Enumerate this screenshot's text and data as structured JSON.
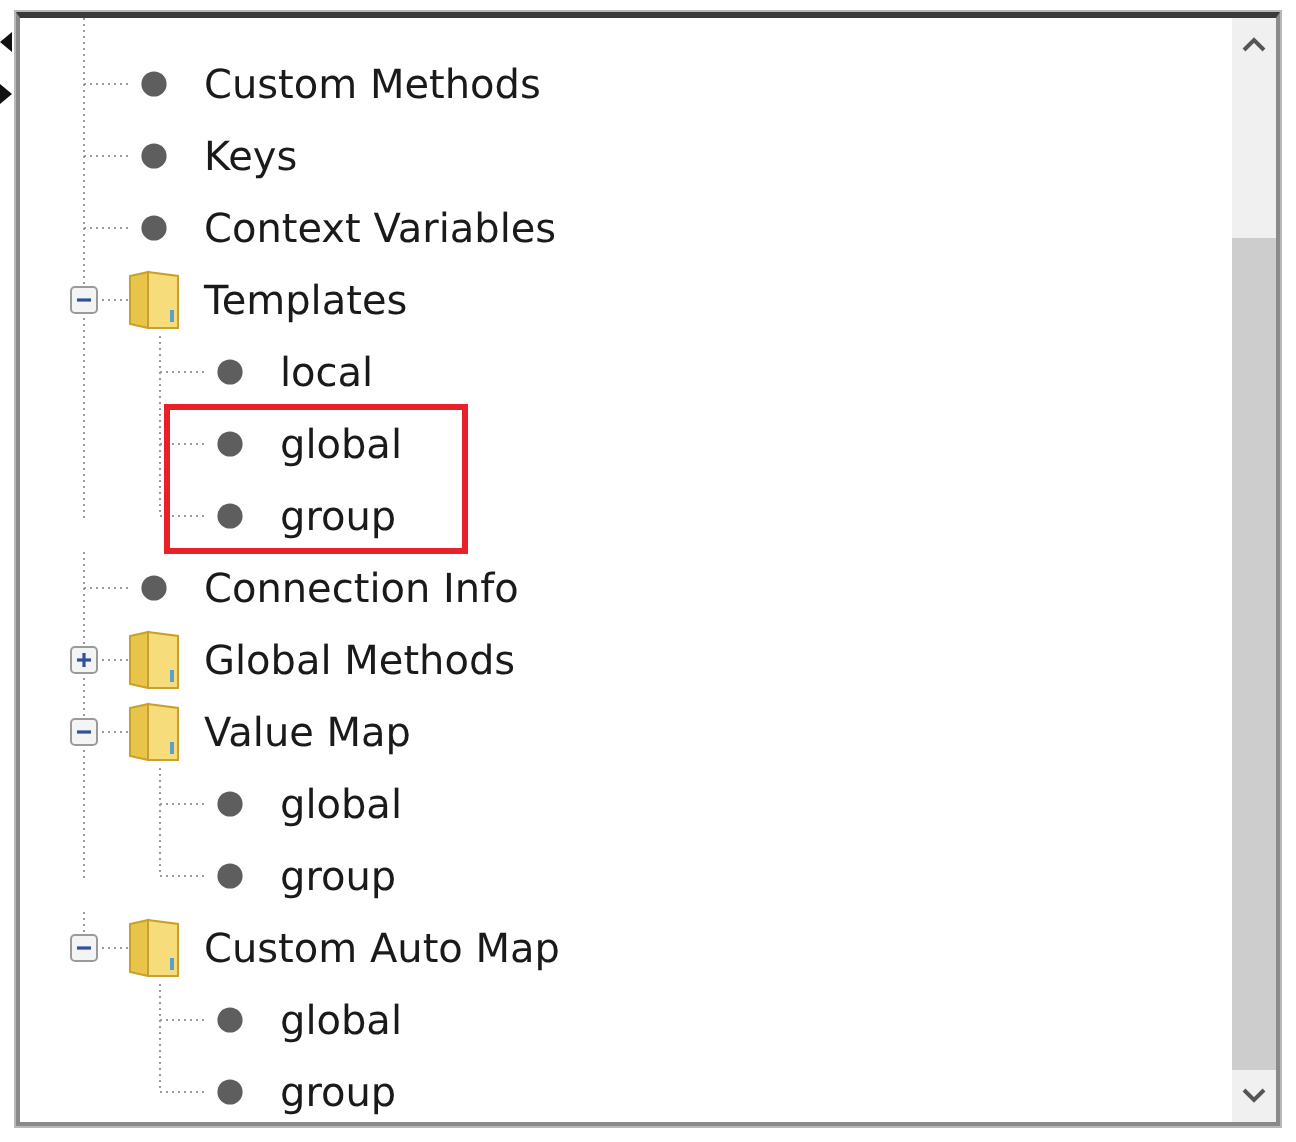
{
  "tree": [
    {
      "kind": "leaf",
      "label": "Custom Methods",
      "highlighted": false
    },
    {
      "kind": "leaf",
      "label": "Keys",
      "highlighted": false
    },
    {
      "kind": "leaf",
      "label": "Context Variables",
      "highlighted": false
    },
    {
      "kind": "folder",
      "label": "Templates",
      "expanded": true,
      "highlighted": false,
      "children": [
        {
          "kind": "leaf",
          "label": "local",
          "highlighted": false
        },
        {
          "kind": "leaf",
          "label": "global",
          "highlighted": true
        },
        {
          "kind": "leaf",
          "label": "group",
          "highlighted": true
        }
      ]
    },
    {
      "kind": "leaf",
      "label": "Connection Info",
      "highlighted": false
    },
    {
      "kind": "folder",
      "label": "Global Methods",
      "expanded": false,
      "highlighted": false
    },
    {
      "kind": "folder",
      "label": "Value Map",
      "expanded": true,
      "highlighted": false,
      "children": [
        {
          "kind": "leaf",
          "label": "global",
          "highlighted": false
        },
        {
          "kind": "leaf",
          "label": "group",
          "highlighted": false
        }
      ]
    },
    {
      "kind": "folder",
      "label": "Custom Auto Map",
      "expanded": true,
      "highlighted": false,
      "children": [
        {
          "kind": "leaf",
          "label": "global",
          "highlighted": false
        },
        {
          "kind": "leaf",
          "label": "group",
          "highlighted": false
        }
      ]
    }
  ]
}
